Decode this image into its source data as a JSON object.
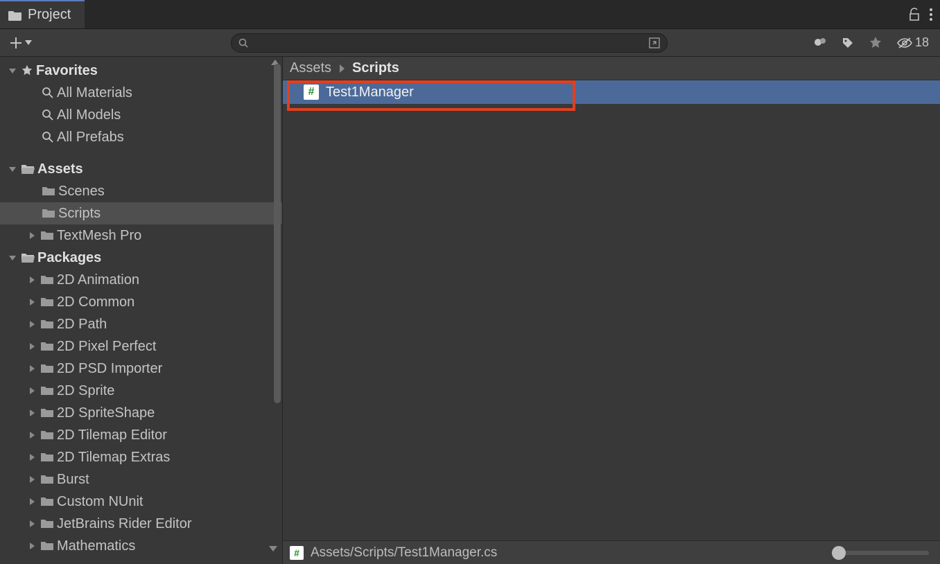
{
  "tab": {
    "label": "Project"
  },
  "toolbar": {
    "hidden_count": "18"
  },
  "search": {
    "placeholder": ""
  },
  "sidebar": {
    "favorites_header": "Favorites",
    "favorites": [
      {
        "label": "All Materials"
      },
      {
        "label": "All Models"
      },
      {
        "label": "All Prefabs"
      }
    ],
    "assets_header": "Assets",
    "assets": [
      {
        "label": "Scenes",
        "has_children": false
      },
      {
        "label": "Scripts",
        "has_children": false,
        "selected": true
      },
      {
        "label": "TextMesh Pro",
        "has_children": true
      }
    ],
    "packages_header": "Packages",
    "packages": [
      {
        "label": "2D Animation"
      },
      {
        "label": "2D Common"
      },
      {
        "label": "2D Path"
      },
      {
        "label": "2D Pixel Perfect"
      },
      {
        "label": "2D PSD Importer"
      },
      {
        "label": "2D Sprite"
      },
      {
        "label": "2D SpriteShape"
      },
      {
        "label": "2D Tilemap Editor"
      },
      {
        "label": "2D Tilemap Extras"
      },
      {
        "label": "Burst"
      },
      {
        "label": "Custom NUnit"
      },
      {
        "label": "JetBrains Rider Editor"
      },
      {
        "label": "Mathematics"
      }
    ]
  },
  "breadcrumb": {
    "root": "Assets",
    "current": "Scripts"
  },
  "files": {
    "items": [
      {
        "label": "Test1Manager"
      }
    ]
  },
  "footer": {
    "path": "Assets/Scripts/Test1Manager.cs"
  }
}
